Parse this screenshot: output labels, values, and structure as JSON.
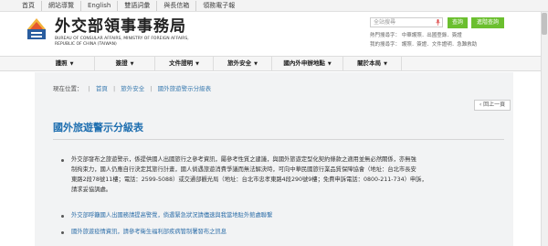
{
  "topbar": {
    "links": [
      "首頁",
      "網站導覽",
      "English",
      "雙語詞彙",
      "與長信箱",
      "領務電子報"
    ]
  },
  "header": {
    "title": "外交部領事事務局",
    "subtitle": "BUREAU OF CONSULAR AFFAIRS, MINISTRY OF FOREIGN AFFAIRS, REPUBLIC OF CHINA (TAIWAN)",
    "search_placeholder": "全站搜尋",
    "search_button": "查詢",
    "advanced_search_button": "進階查詢",
    "hot_line1": "熱門搜尋字：  中華護照．出國登錄．簽證",
    "hot_line2": "我的搜尋字：  護照．簽證．文件證明．急難救助"
  },
  "nav": {
    "items": [
      "護照",
      "簽證",
      "文件證明",
      "旅外安全",
      "國內外申辦地點",
      "關於本局"
    ]
  },
  "breadcrumb": {
    "label": "現在位置：",
    "items": [
      "首頁",
      "旅外安全",
      "國外旅遊警示分級表"
    ]
  },
  "back_button": "回上一頁",
  "page_title": "國外旅遊警示分級表",
  "content": {
    "para1_lines": [
      "外交部發布之旅遊警示，係提供國人出國旅行之參考資訊，屬參考性質之建議，與國外旅遊定型化契約條款之適用並無必然關係，亦無強",
      "制拘束力，國人仍應自行決定其旅行計畫，國人倘遇旅遊消費爭議而無法解決時，可向中華民國旅行業品質保障協會（地址：台北市長安",
      "東路2段78號11樓；電話：2599-5088）或交通部觀光局（地址：台北市忠孝東路4段290號9樓；免費申訴電話：0800-211-734）申訴，",
      "請求妥協調處。"
    ],
    "link1": "外交部呼籲國人出國務請提高警覺，倘遇緊急狀況請儘速與我當地駐外館處聯繫",
    "link2": "國外旅遊疫情資訊，請參考衛生福利部疾病管制署發布之訊息"
  },
  "colors": {
    "accent_green": "#6bbf2f",
    "link_blue": "#1f6fb0",
    "content_bg": "#f2f3f4"
  }
}
